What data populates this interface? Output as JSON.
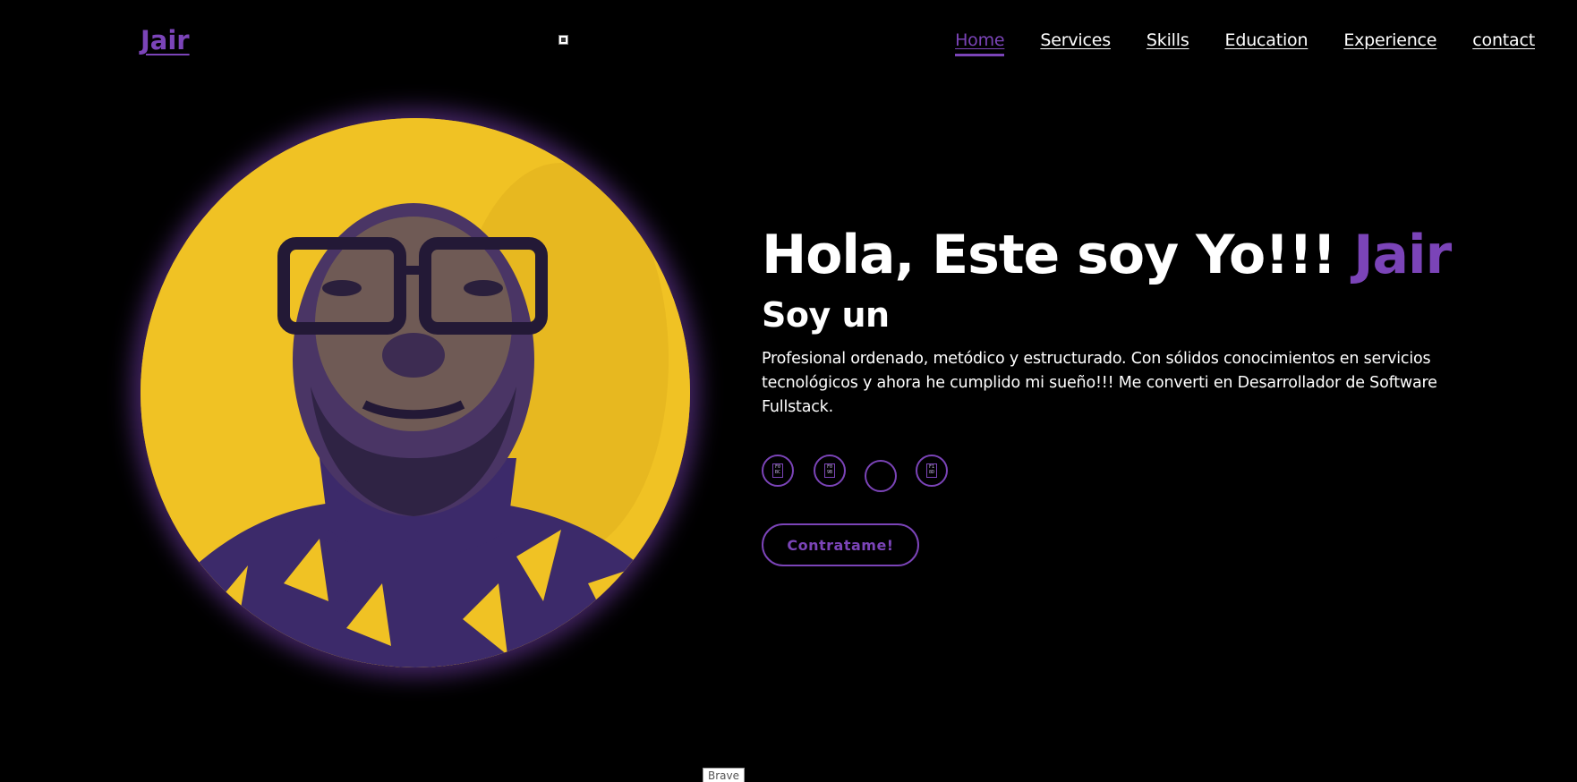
{
  "header": {
    "logo": "Jair",
    "nav": [
      {
        "label": "Home",
        "active": true
      },
      {
        "label": "Services",
        "active": false
      },
      {
        "label": "Skills",
        "active": false
      },
      {
        "label": "Education",
        "active": false
      },
      {
        "label": "Experience",
        "active": false
      },
      {
        "label": "contact",
        "active": false
      }
    ]
  },
  "hero": {
    "title_prefix": "Hola, Este soy Yo!!! ",
    "title_name": "Jair",
    "subtitle": "Soy un",
    "description": "Profesional ordenado, metódico y estructurado. Con sólidos conocimientos en servicios tecnológicos y ahora he cumplido mi sueño!!! Me converti en Desarrollador de Software Fullstack.",
    "social_icons": [
      "broken-glyph-icon",
      "broken-glyph-icon",
      "empty-circle-icon",
      "broken-glyph-icon"
    ],
    "social_glyphs": [
      "F0 BC",
      "F0 9B",
      "",
      "F1 8D"
    ],
    "cta_label": "Contratame!"
  },
  "tooltip": "Brave",
  "colors": {
    "accent": "#7b44b8",
    "background": "#000000",
    "text": "#ffffff",
    "photo_yellow": "#f0c224",
    "photo_purple": "#3c2a6a"
  }
}
